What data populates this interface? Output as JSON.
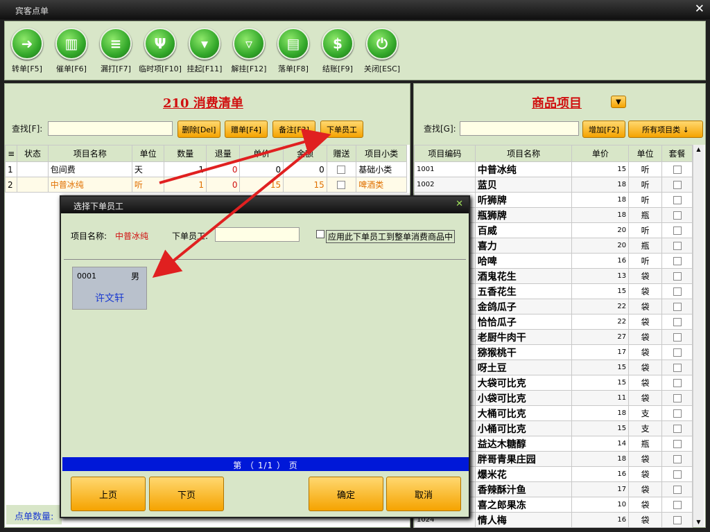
{
  "window": {
    "title": "宾客点单"
  },
  "toolbar": [
    {
      "label": "转单[F5]",
      "icon": "arrow-forward-icon",
      "glyph": "➜"
    },
    {
      "label": "催单[F6]",
      "icon": "bank-icon",
      "glyph": "▥"
    },
    {
      "label": "漏打[F7]",
      "icon": "document-icon",
      "glyph": "≡"
    },
    {
      "label": "临时项[F10]",
      "icon": "utensils-icon",
      "glyph": "Ψ"
    },
    {
      "label": "挂起[F11]",
      "icon": "tie-icon",
      "glyph": "▾"
    },
    {
      "label": "解挂[F12]",
      "icon": "tie-unhang-icon",
      "glyph": "▿"
    },
    {
      "label": "落单[F8]",
      "icon": "order-icon",
      "glyph": "▤"
    },
    {
      "label": "结账[F9]",
      "icon": "dollar-icon",
      "glyph": "$"
    },
    {
      "label": "关闭[ESC]",
      "icon": "power-icon",
      "glyph": "⏻"
    }
  ],
  "left_panel": {
    "title": "210 消费清单",
    "search_label": "查找[F]:",
    "buttons": [
      "删除[Del]",
      "赠单[F4]",
      "备注[F3]",
      "下单员工"
    ],
    "columns": [
      "≡",
      "状态",
      "项目名称",
      "单位",
      "数量",
      "退量",
      "单价",
      "金额",
      "赠送",
      "项目小类"
    ],
    "rows": [
      {
        "no": "1",
        "status": "",
        "name": "包间费",
        "unit": "天",
        "qty": "1",
        "ret": "0",
        "price": "0",
        "amount": "0",
        "cat": "基础小类"
      },
      {
        "no": "2",
        "status": "",
        "name": "中普冰纯",
        "unit": "听",
        "qty": "1",
        "ret": "0",
        "price": "15",
        "amount": "15",
        "cat": "啤酒类"
      }
    ],
    "footer": "点单数量:"
  },
  "right_panel": {
    "title": "商品项目",
    "search_label": "查找[G]:",
    "buttons": [
      "增加[F2]",
      "所有项目类 ↓"
    ],
    "columns": [
      "项目编码",
      "项目名称",
      "单价",
      "单位",
      "套餐"
    ],
    "rows": [
      {
        "code": "1001",
        "name": "中普冰纯",
        "price": "15",
        "unit": "听"
      },
      {
        "code": "1002",
        "name": "蓝贝",
        "price": "18",
        "unit": "听"
      },
      {
        "code": "",
        "name": "听狮牌",
        "price": "18",
        "unit": "听"
      },
      {
        "code": "",
        "name": "瓶狮牌",
        "price": "18",
        "unit": "瓶"
      },
      {
        "code": "",
        "name": "百威",
        "price": "20",
        "unit": "听"
      },
      {
        "code": "",
        "name": "喜力",
        "price": "20",
        "unit": "瓶"
      },
      {
        "code": "",
        "name": "哈啤",
        "price": "16",
        "unit": "听"
      },
      {
        "code": "",
        "name": "酒鬼花生",
        "price": "13",
        "unit": "袋"
      },
      {
        "code": "",
        "name": "五香花生",
        "price": "15",
        "unit": "袋"
      },
      {
        "code": "",
        "name": "金鸽瓜子",
        "price": "22",
        "unit": "袋"
      },
      {
        "code": "",
        "name": "恰恰瓜子",
        "price": "22",
        "unit": "袋"
      },
      {
        "code": "",
        "name": "老厨牛肉干",
        "price": "27",
        "unit": "袋"
      },
      {
        "code": "",
        "name": "猕猴桃干",
        "price": "17",
        "unit": "袋"
      },
      {
        "code": "",
        "name": "呀土豆",
        "price": "15",
        "unit": "袋"
      },
      {
        "code": "",
        "name": "大袋可比克",
        "price": "15",
        "unit": "袋"
      },
      {
        "code": "",
        "name": "小袋可比克",
        "price": "11",
        "unit": "袋"
      },
      {
        "code": "",
        "name": "大桶可比克",
        "price": "18",
        "unit": "支"
      },
      {
        "code": "",
        "name": "小桶可比克",
        "price": "15",
        "unit": "支"
      },
      {
        "code": "",
        "name": "益达木糖醇",
        "price": "14",
        "unit": "瓶"
      },
      {
        "code": "",
        "name": "胖哥青果庄园",
        "price": "18",
        "unit": "袋"
      },
      {
        "code": "",
        "name": "爆米花",
        "price": "16",
        "unit": "袋"
      },
      {
        "code": "",
        "name": "香辣酥汁鱼",
        "price": "17",
        "unit": "袋"
      },
      {
        "code": "",
        "name": "喜之郎果冻",
        "price": "10",
        "unit": "袋"
      },
      {
        "code": "1024",
        "name": "情人梅",
        "price": "16",
        "unit": "袋"
      }
    ]
  },
  "dialog": {
    "title": "选择下单员工",
    "item_label": "项目名称:",
    "item_value": "中普冰纯",
    "staff_label": "下单员工:",
    "staff_value": "",
    "apply_label": "应用此下单员工到整单消费商品中",
    "employee": {
      "code": "0001",
      "gender": "男",
      "name": "许文轩"
    },
    "pager": "第 （ 1/1 ） 页",
    "buttons": {
      "prev": "上页",
      "next": "下页",
      "ok": "确定",
      "cancel": "取消"
    }
  }
}
